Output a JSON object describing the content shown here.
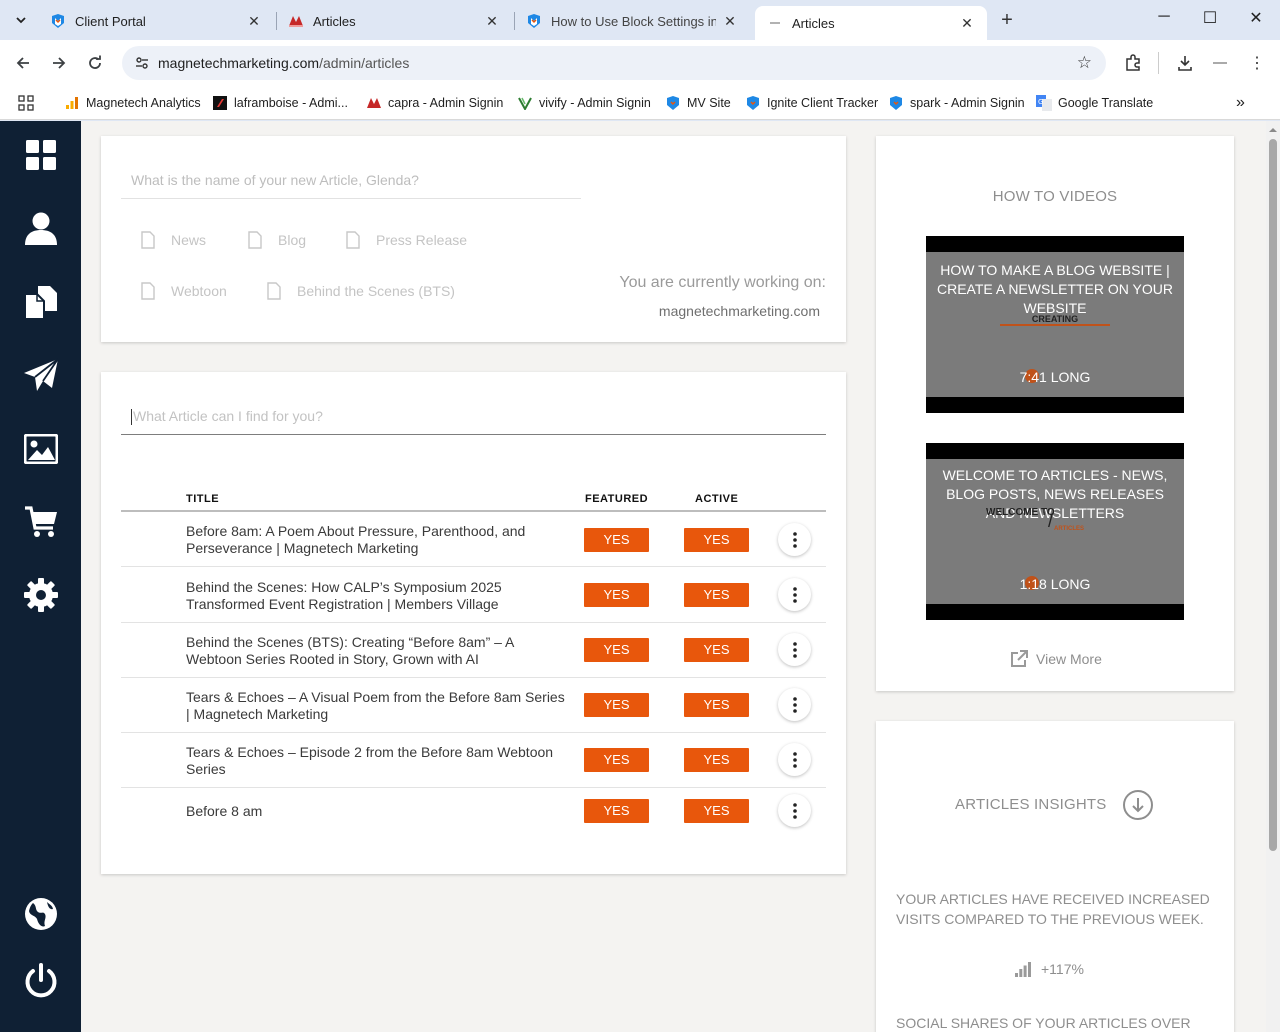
{
  "browser": {
    "tabs": [
      {
        "title": "Client Portal",
        "icon": "magnetech-logo-icon"
      },
      {
        "title": "Articles",
        "icon": "capra-logo-icon"
      },
      {
        "title": "How to Use Block Settings in th",
        "icon": "magnetech-logo-icon"
      },
      {
        "title": "Articles",
        "icon": "loading-icon"
      }
    ],
    "url_domain": "magnetechmarketing.com",
    "url_path": "/admin/articles",
    "bookmarks": [
      {
        "label": "Magnetech Analytics",
        "icon": "analytics-icon"
      },
      {
        "label": "laframboise - Admi...",
        "icon": "laframboise-icon"
      },
      {
        "label": "capra - Admin Signin",
        "icon": "capra-logo-icon"
      },
      {
        "label": "vivify - Admin Signin",
        "icon": "vivify-icon"
      },
      {
        "label": "MV Site",
        "icon": "magnetech-logo-icon"
      },
      {
        "label": "Ignite Client Tracker",
        "icon": "magnetech-logo-icon"
      },
      {
        "label": "spark - Admin Signin",
        "icon": "magnetech-logo-icon"
      },
      {
        "label": "Google Translate",
        "icon": "google-translate-icon"
      }
    ]
  },
  "sidebar": {
    "items": [
      "dashboard-icon",
      "user-icon",
      "documents-icon",
      "send-icon",
      "image-icon",
      "cart-icon",
      "settings-icon",
      "globe-icon",
      "power-icon"
    ]
  },
  "new_article": {
    "placeholder": "What is the name of your new Article, Glenda?",
    "types": [
      "News",
      "Blog",
      "Press Release",
      "Webtoon",
      "Behind the Scenes (BTS)"
    ],
    "working_on_label": "You are currently working on:",
    "working_on_site": "magnetechmarketing.com"
  },
  "articles": {
    "search_placeholder": "What Article can I find for you?",
    "columns": {
      "title": "TITLE",
      "featured": "FEATURED",
      "active": "ACTIVE"
    },
    "rows": [
      {
        "title": "Before 8am: A Poem About Pressure, Parenthood, and Perseverance | Magnetech Marketing",
        "featured": "YES",
        "active": "YES"
      },
      {
        "title": "Behind the Scenes: How CALP’s Symposium 2025 Transformed Event Registration | Members Village",
        "featured": "YES",
        "active": "YES"
      },
      {
        "title": "Behind the Scenes (BTS): Creating “Before 8am” – A Webtoon Series Rooted in Story, Grown with AI",
        "featured": "YES",
        "active": "YES"
      },
      {
        "title": "Tears & Echoes – A Visual Poem from the Before 8am Series | Magnetech Marketing",
        "featured": "YES",
        "active": "YES"
      },
      {
        "title": "Tears & Echoes – Episode 2 from the Before 8am Webtoon Series",
        "featured": "YES",
        "active": "YES"
      },
      {
        "title": "Before 8 am",
        "featured": "YES",
        "active": "YES"
      }
    ]
  },
  "how_to": {
    "heading": "HOW TO VIDEOS",
    "videos": [
      {
        "title": "HOW TO MAKE A BLOG WEBSITE | CREATE A NEWSLETTER ON YOUR WEBSITE",
        "overlay_text": "CREATING",
        "length": "7:41 LONG"
      },
      {
        "title": "WELCOME TO ARTICLES - NEWS, BLOG POSTS, NEWS RELEASES AND NEWSLETTERS",
        "overlay_text": "WELCOME TO",
        "overlay_text2": "ARTICLES",
        "length": "1:18 LONG"
      }
    ],
    "view_more": "View More"
  },
  "insights": {
    "heading": "ARTICLES INSIGHTS",
    "visits_text": "YOUR ARTICLES HAVE RECEIVED INCREASED VISITS COMPARED TO THE PREVIOUS WEEK.",
    "visits_change": "+117%",
    "shares_text": "SOCIAL SHARES OF YOUR ARTICLES OVER"
  },
  "colors": {
    "sidebar_bg": "#0f2034",
    "accent_orange": "#e8570c",
    "page_bg": "#f4f3f1"
  }
}
